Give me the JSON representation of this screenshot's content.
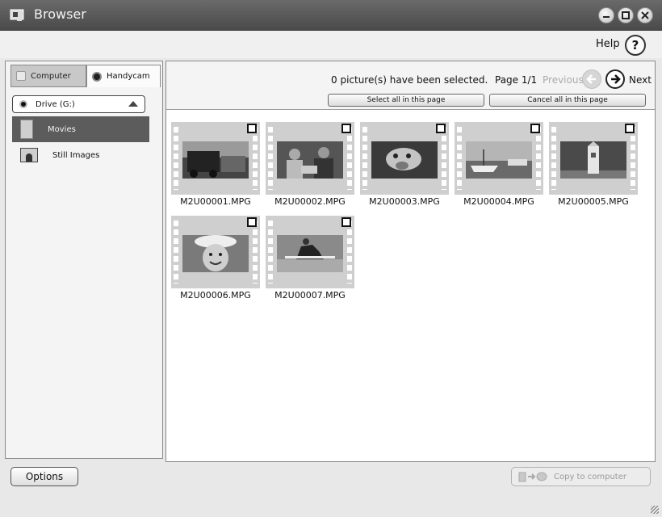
{
  "window": {
    "title": "Browser",
    "icons": {
      "app": "browser-app-icon",
      "minimize": "minimize-icon",
      "maximize": "maximize-icon",
      "close": "close-icon"
    }
  },
  "helpbar": {
    "help_label": "Help",
    "help_glyph": "?"
  },
  "sidebar": {
    "tabs": [
      {
        "label": "Computer",
        "icon": "computer-icon"
      },
      {
        "label": "Handycam",
        "icon": "handycam-icon"
      }
    ],
    "drive": {
      "label": "Drive (G:)"
    },
    "items": [
      {
        "label": "Movies",
        "icon": "film-icon",
        "selected": true
      },
      {
        "label": "Still Images",
        "icon": "picture-icon",
        "selected": false
      }
    ]
  },
  "main": {
    "selection_text": "0 picture(s) have been selected.",
    "page_text": "Page 1/1",
    "previous_label": "Previous",
    "next_label": "Next",
    "select_all_label": "Select all in this page",
    "cancel_all_label": "Cancel all in this page",
    "files": [
      {
        "name": "M2U00001.MPG",
        "checked": false
      },
      {
        "name": "M2U00002.MPG",
        "checked": false
      },
      {
        "name": "M2U00003.MPG",
        "checked": false
      },
      {
        "name": "M2U00004.MPG",
        "checked": false
      },
      {
        "name": "M2U00005.MPG",
        "checked": false
      },
      {
        "name": "M2U00006.MPG",
        "checked": false
      },
      {
        "name": "M2U00007.MPG",
        "checked": false
      }
    ]
  },
  "footer": {
    "options_label": "Options",
    "copy_label": "Copy to computer"
  }
}
